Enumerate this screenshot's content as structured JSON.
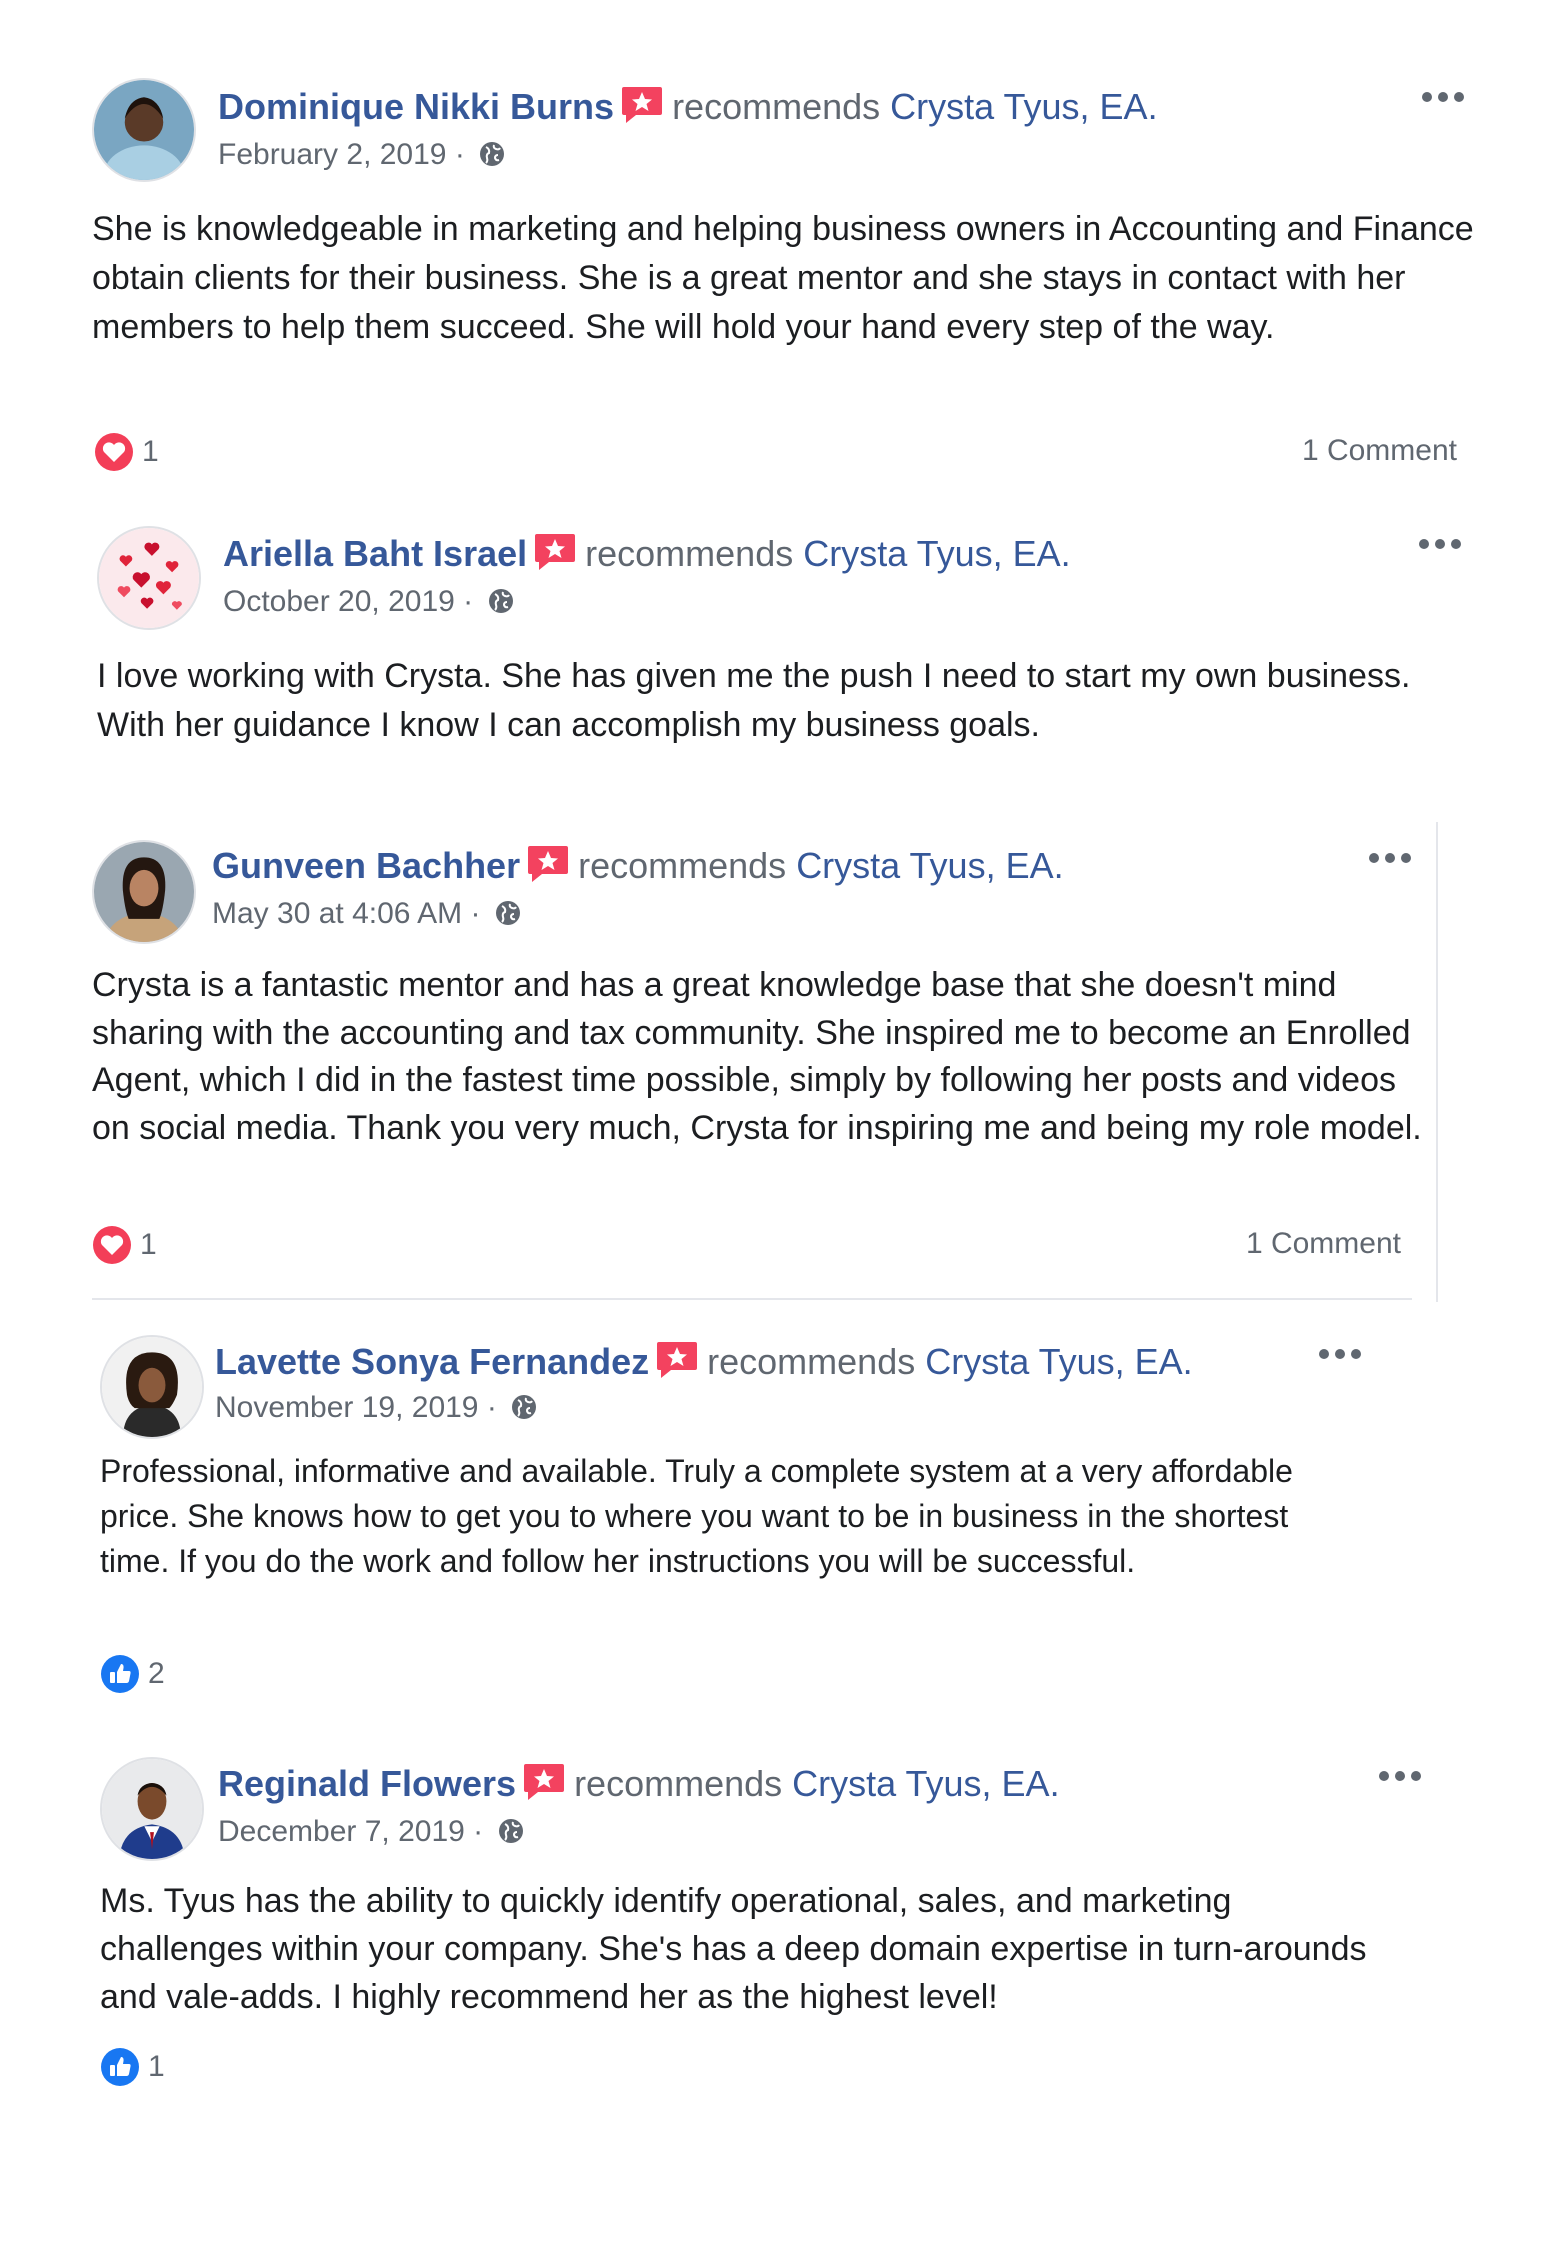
{
  "common": {
    "recommends": "recommends",
    "page_name": "Crysta Tyus, EA.",
    "separator": "·"
  },
  "colors": {
    "link": "#365899",
    "secondary_text": "#606770",
    "love": "#f33e58",
    "like": "#1877f2"
  },
  "posts": [
    {
      "author": "Dominique Nikki Burns",
      "date": "February 2, 2019",
      "privacy_icon": "globe-icon",
      "text": "She is knowledgeable in marketing and helping business owners in Accounting and Finance obtain clients for their business. She is a great mentor and she stays in contact with her members to help them succeed. She will hold your hand every step of the way.",
      "reaction_icon": "love-icon",
      "reaction_count": "1",
      "comments": "1 Comment"
    },
    {
      "author": "Ariella Baht Israel",
      "date": "October 20, 2019",
      "privacy_icon": "globe-icon",
      "text": "I love working with Crysta. She has given me the push I need to start my own business. With her guidance I know I can accomplish my business goals."
    },
    {
      "author": "Gunveen Bachher",
      "date": "May 30 at 4:06 AM",
      "privacy_icon": "globe-icon",
      "text": "Crysta is a fantastic mentor and has a great knowledge base that she doesn't mind sharing with the accounting and tax community. She inspired me to become an Enrolled Agent, which I did in the fastest time possible, simply by following her posts and videos on social media. Thank you very much, Crysta for inspiring me and being my role model.",
      "reaction_icon": "love-icon",
      "reaction_count": "1",
      "comments": "1 Comment"
    },
    {
      "author": "Lavette Sonya Fernandez",
      "date": "November 19, 2019",
      "privacy_icon": "globe-icon",
      "text": "Professional, informative and available. Truly a complete system at a very affordable price. She knows how to get you to where you want to be in business in the shortest time. If you do the work and follow her instructions you will be successful.",
      "reaction_icon": "like-icon",
      "reaction_count": "2"
    },
    {
      "author": "Reginald Flowers",
      "date": "December 7, 2019",
      "privacy_icon": "globe-icon",
      "text": "Ms. Tyus has the ability to quickly identify operational, sales, and marketing challenges within your company. She's has a deep domain expertise in turn-arounds and vale-adds. I highly recommend her as the highest level!",
      "reaction_icon": "like-icon",
      "reaction_count": "1"
    }
  ]
}
